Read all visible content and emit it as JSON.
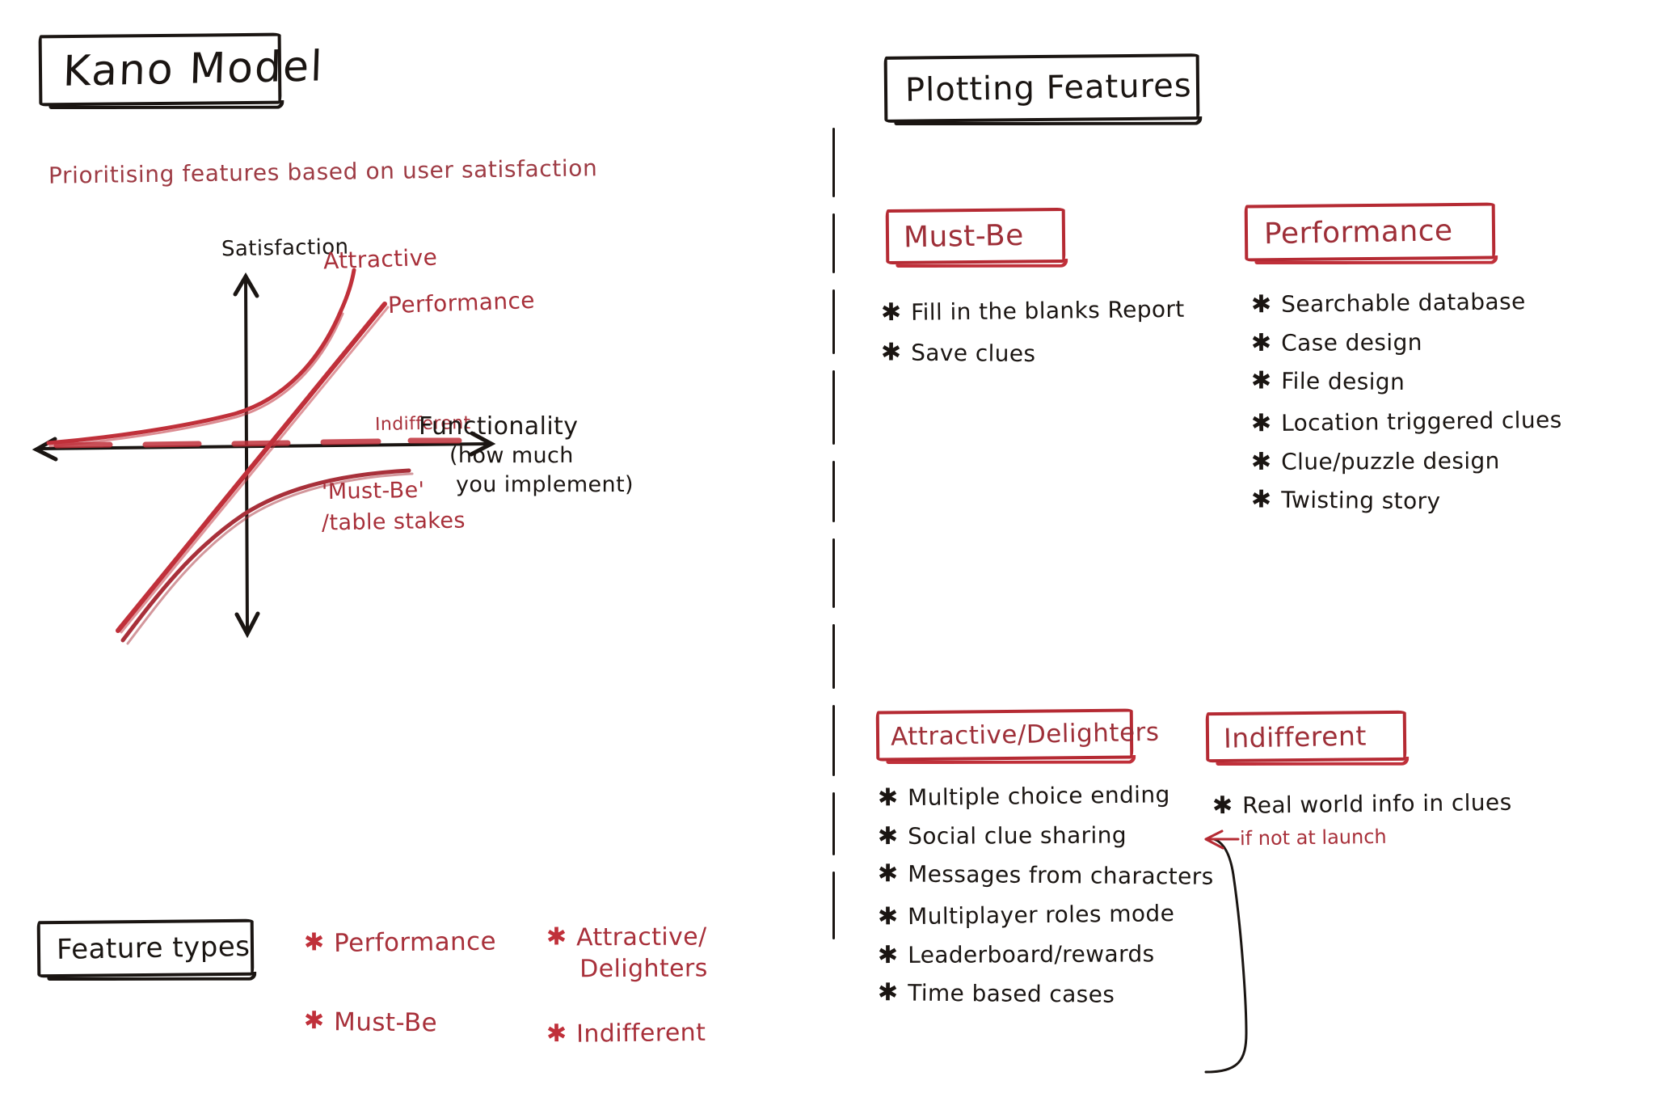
{
  "board": {
    "background_color": "#ffffff",
    "ink_black": "#1a1512",
    "ink_red": "#b52a33"
  },
  "header": {
    "title": "Kano Model",
    "subtitle": "Prioritising features based on user satisfaction"
  },
  "chart_data": {
    "type": "line",
    "title": "Kano Model",
    "xlabel": "Functionality",
    "xlabel_note": "(how much you implement)",
    "ylabel": "Satisfaction",
    "xlim": [
      -1,
      1
    ],
    "ylim": [
      -1,
      1
    ],
    "grid": false,
    "legend_position": "inline-curve-labels",
    "axis_style": "double-headed arrows through origin",
    "series": [
      {
        "name": "Attractive",
        "color": "#c0303a",
        "label": "Attractive",
        "shape": "exponential-rise",
        "description": "Starts flat near zero satisfaction at low functionality, rises steeply to high satisfaction",
        "x": [
          -1.0,
          -0.6,
          -0.2,
          0.1,
          0.35,
          0.55,
          0.7,
          0.8
        ],
        "y": [
          -0.02,
          0.02,
          0.08,
          0.2,
          0.42,
          0.68,
          0.88,
          1.0
        ]
      },
      {
        "name": "Performance",
        "color": "#c0303a",
        "label": "Performance",
        "shape": "linear",
        "description": "Straight diagonal line through the origin from low-left to high-right",
        "x": [
          -0.95,
          -0.5,
          0.0,
          0.5,
          0.95
        ],
        "y": [
          -1.0,
          -0.52,
          0.0,
          0.5,
          0.95
        ]
      },
      {
        "name": "Must-Be",
        "color": "#c0303a",
        "label": "'Must-Be' /table stakes",
        "shape": "logarithmic-saturating",
        "description": "Rises steeply from deep dissatisfaction then saturates just below zero",
        "x": [
          -1.0,
          -0.8,
          -0.5,
          -0.2,
          0.2,
          0.6,
          0.9
        ],
        "y": [
          -1.0,
          -0.7,
          -0.42,
          -0.26,
          -0.16,
          -0.12,
          -0.1
        ]
      },
      {
        "name": "Indifferent",
        "color": "#c0303a",
        "label": "Indifferent",
        "shape": "flat-dashed",
        "description": "Flat dashed line sitting on the functionality axis at zero satisfaction",
        "x": [
          -1.0,
          1.0
        ],
        "y": [
          0.0,
          0.0
        ]
      }
    ],
    "axis_labels": {
      "y_positive": "Satisfaction",
      "x_positive": "Functionality",
      "x_positive_note_line1": "(how much",
      "x_positive_note_line2": "you implement)"
    },
    "annotations": [
      {
        "text": "Attractive",
        "color": "#a8303a"
      },
      {
        "text": "Performance",
        "color": "#a8303a"
      },
      {
        "text": "Indifferent",
        "color": "#a8303a"
      },
      {
        "text": "'Must-Be'",
        "color": "#a8303a"
      },
      {
        "text": "/table stakes",
        "color": "#a8303a"
      }
    ]
  },
  "legend": {
    "box_label": "Feature types",
    "column_one": [
      {
        "label": "Performance"
      },
      {
        "label": "Must-Be"
      }
    ],
    "column_two": [
      {
        "label_line1": "Attractive/",
        "label_line2": "Delighters"
      },
      {
        "label_line1": "Indifferent",
        "label_line2": ""
      }
    ]
  },
  "right_panel": {
    "title": "Plotting Features",
    "sections": [
      {
        "key": "must-be",
        "heading": "Must-Be",
        "items": [
          "Fill in the blanks Report",
          "Save clues"
        ]
      },
      {
        "key": "performance",
        "heading": "Performance",
        "items": [
          "Searchable database",
          "Case design",
          "File design",
          "Location triggered clues",
          "Clue/puzzle design",
          "Twisting story"
        ]
      },
      {
        "key": "attractive-delighters",
        "heading": "Attractive/Delighters",
        "items": [
          "Multiple choice ending",
          "Social clue sharing",
          "Messages from characters",
          "Multiplayer roles mode",
          "Leaderboard/rewards",
          "Time based cases"
        ]
      },
      {
        "key": "indifferent",
        "heading": "Indifferent",
        "items": [
          "Real world info in clues"
        ],
        "annotation": "if not at launch"
      }
    ]
  }
}
